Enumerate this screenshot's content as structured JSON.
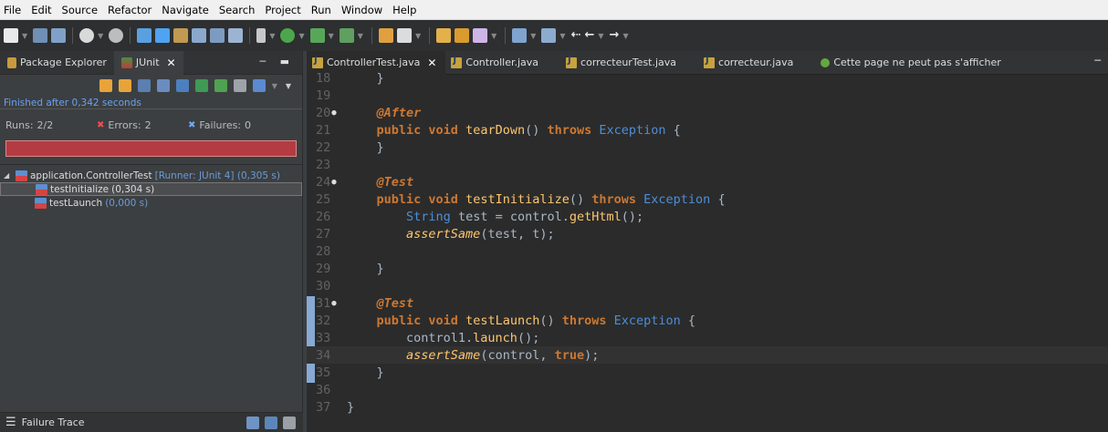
{
  "menu": [
    {
      "label": "File"
    },
    {
      "label": "Edit"
    },
    {
      "label": "Source"
    },
    {
      "label": "Refactor"
    },
    {
      "label": "Navigate"
    },
    {
      "label": "Search"
    },
    {
      "label": "Project"
    },
    {
      "label": "Run"
    },
    {
      "label": "Window"
    },
    {
      "label": "Help"
    }
  ],
  "left_panel": {
    "tabs": [
      {
        "label": "Package Explorer",
        "icon": "package-explorer-icon"
      },
      {
        "label": "JUnit",
        "icon": "junit-icon"
      }
    ],
    "finished": "Finished after 0,342 seconds",
    "runs_label": "Runs:",
    "runs_value": "2/2",
    "errors_label": "Errors:",
    "errors_value": "2",
    "failures_label": "Failures:",
    "failures_value": "0",
    "progress_color": "#b53b43",
    "tree": {
      "root": {
        "name": "application.ControllerTest",
        "detail": "[Runner: JUnit 4] (0,305 s)"
      },
      "children": [
        {
          "name": "testInitialize",
          "time": "(0,304 s)"
        },
        {
          "name": "testLaunch",
          "time": "(0,000 s)"
        }
      ]
    },
    "bottom_view": "Failure Trace"
  },
  "editor": {
    "tabs": [
      {
        "label": "ControllerTest.java",
        "active": true
      },
      {
        "label": "Controller.java"
      },
      {
        "label": "correcteurTest.java"
      },
      {
        "label": "correcteur.java"
      },
      {
        "label": "Cette page ne peut pas s'afficher"
      }
    ],
    "line_numbers": [
      "18",
      "19",
      "20",
      "21",
      "22",
      "23",
      "24",
      "25",
      "26",
      "27",
      "28",
      "29",
      "30",
      "31",
      "32",
      "33",
      "34",
      "35",
      "36",
      "37"
    ]
  }
}
